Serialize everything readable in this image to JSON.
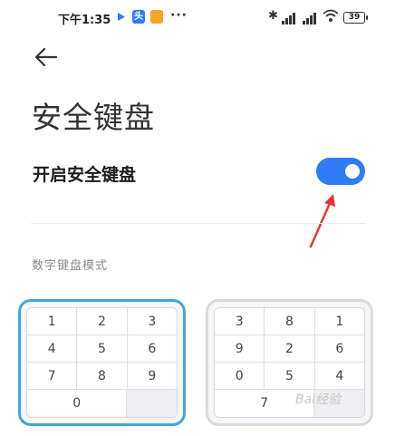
{
  "status_bar": {
    "time": "下午1:35",
    "app_badge_text": "头",
    "more": "···",
    "bluetooth": "✱",
    "battery": "39"
  },
  "header": {
    "back_icon": "arrow-left-icon",
    "title": "安全键盘"
  },
  "setting": {
    "label": "开启安全键盘",
    "toggle_on": true,
    "accent": "#2f7cf6"
  },
  "section": {
    "label": "数字键盘模式"
  },
  "keypads": {
    "ordered": {
      "rows": [
        [
          "1",
          "2",
          "3"
        ],
        [
          "4",
          "5",
          "6"
        ],
        [
          "7",
          "8",
          "9"
        ]
      ],
      "last": "0",
      "border": "#3fa7dc"
    },
    "random": {
      "rows": [
        [
          "3",
          "8",
          "1"
        ],
        [
          "9",
          "2",
          "6"
        ],
        [
          "0",
          "5",
          "4"
        ]
      ],
      "last": "7",
      "border": "#d9dbe0"
    }
  },
  "annotation": {
    "arrow_color": "#e53935"
  }
}
